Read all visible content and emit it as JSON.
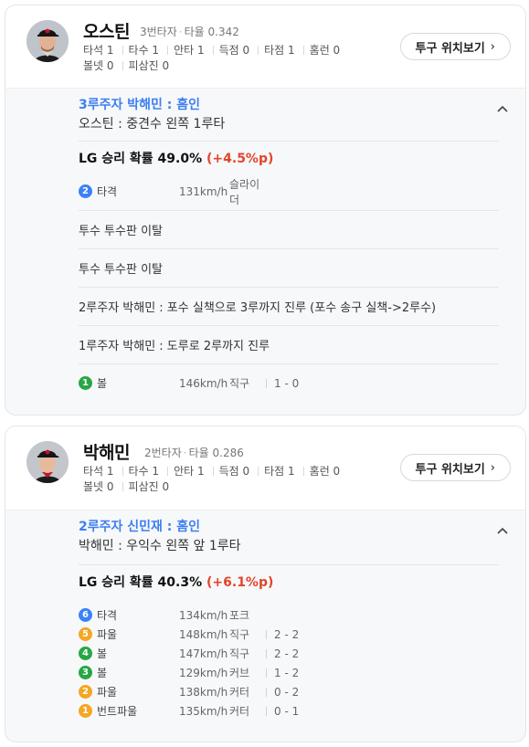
{
  "colors": {
    "blue": "#3d7ff0",
    "red_delta": "#e2452c",
    "badge_blue": "#3b82f6",
    "badge_orange": "#f5a623",
    "badge_green": "#27a745"
  },
  "cards": [
    {
      "player": {
        "name": "오스틴",
        "order": "3번타자",
        "avg_label": "타율",
        "avg": "0.342",
        "icon": "player-avatar"
      },
      "stats": [
        "타석 1",
        "타수 1",
        "안타 1",
        "득점 0",
        "타점 1",
        "홈런 0",
        "볼넷 0",
        "피삼진 0"
      ],
      "button_label": "투구 위치보기",
      "result_title": "3루주자 박해민 : 홈인",
      "result_desc": "오스틴 : 중견수 왼쪽 1루타",
      "win_prob": {
        "text": "LG 승리 확률 49.0%",
        "delta": "(+4.5%p)"
      },
      "pitches": [
        {
          "num": "2",
          "color": "#3b82f6",
          "label": "타격",
          "speed": "131km/h",
          "type": "슬라이더",
          "count": ""
        }
      ],
      "events": [
        "투수 투수판 이탈",
        "투수 투수판 이탈",
        "2루주자 박해민 : 포수 실책으로 3루까지 진루 (포수 송구 실책->2루수)",
        "1루주자 박해민 : 도루로 2루까지 진루"
      ],
      "pitches2": [
        {
          "num": "1",
          "color": "#27a745",
          "label": "볼",
          "speed": "146km/h",
          "type": "직구",
          "count": "1 - 0"
        }
      ]
    },
    {
      "player": {
        "name": "박해민",
        "order": "2번타자",
        "avg_label": "타율",
        "avg": "0.286",
        "icon": "player-avatar"
      },
      "stats": [
        "타석 1",
        "타수 1",
        "안타 1",
        "득점 0",
        "타점 1",
        "홈런 0",
        "볼넷 0",
        "피삼진 0"
      ],
      "button_label": "투구 위치보기",
      "result_title": "2루주자 신민재 : 홈인",
      "result_desc": "박해민 : 우익수 왼쪽 앞 1루타",
      "win_prob": {
        "text": "LG 승리 확률 40.3%",
        "delta": "(+6.1%p)"
      },
      "pitches": [
        {
          "num": "6",
          "color": "#3b82f6",
          "label": "타격",
          "speed": "134km/h",
          "type": "포크",
          "count": ""
        },
        {
          "num": "5",
          "color": "#f5a623",
          "label": "파울",
          "speed": "148km/h",
          "type": "직구",
          "count": "2 - 2"
        },
        {
          "num": "4",
          "color": "#27a745",
          "label": "볼",
          "speed": "147km/h",
          "type": "직구",
          "count": "2 - 2"
        },
        {
          "num": "3",
          "color": "#27a745",
          "label": "볼",
          "speed": "129km/h",
          "type": "커브",
          "count": "1 - 2"
        },
        {
          "num": "2",
          "color": "#f5a623",
          "label": "파울",
          "speed": "138km/h",
          "type": "커터",
          "count": "0 - 2"
        },
        {
          "num": "1",
          "color": "#f5a623",
          "label": "번트파울",
          "speed": "135km/h",
          "type": "커터",
          "count": "0 - 1"
        }
      ]
    }
  ]
}
